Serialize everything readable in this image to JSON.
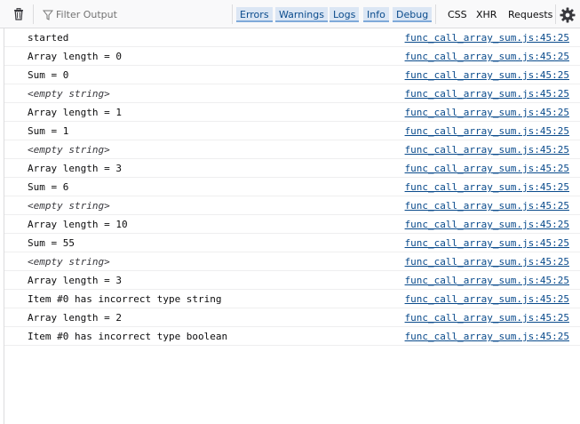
{
  "toolbar": {
    "filter_placeholder": "Filter Output",
    "levels": [
      "Errors",
      "Warnings",
      "Logs",
      "Info",
      "Debug"
    ],
    "requests": [
      "CSS",
      "XHR",
      "Requests"
    ]
  },
  "log": {
    "rows": [
      {
        "message": "started",
        "source": "func_call_array_sum.js:45:25",
        "empty": false
      },
      {
        "message": "Array length = 0",
        "source": "func_call_array_sum.js:45:25",
        "empty": false
      },
      {
        "message": "Sum = 0",
        "source": "func_call_array_sum.js:45:25",
        "empty": false
      },
      {
        "message": "<empty string>",
        "source": "func_call_array_sum.js:45:25",
        "empty": true
      },
      {
        "message": "Array length = 1",
        "source": "func_call_array_sum.js:45:25",
        "empty": false
      },
      {
        "message": "Sum = 1",
        "source": "func_call_array_sum.js:45:25",
        "empty": false
      },
      {
        "message": "<empty string>",
        "source": "func_call_array_sum.js:45:25",
        "empty": true
      },
      {
        "message": "Array length = 3",
        "source": "func_call_array_sum.js:45:25",
        "empty": false
      },
      {
        "message": "Sum = 6",
        "source": "func_call_array_sum.js:45:25",
        "empty": false
      },
      {
        "message": "<empty string>",
        "source": "func_call_array_sum.js:45:25",
        "empty": true
      },
      {
        "message": "Array length = 10",
        "source": "func_call_array_sum.js:45:25",
        "empty": false
      },
      {
        "message": "Sum = 55",
        "source": "func_call_array_sum.js:45:25",
        "empty": false
      },
      {
        "message": "<empty string>",
        "source": "func_call_array_sum.js:45:25",
        "empty": true
      },
      {
        "message": "Array length = 3",
        "source": "func_call_array_sum.js:45:25",
        "empty": false
      },
      {
        "message": "Item #0 has incorrect type string",
        "source": "func_call_array_sum.js:45:25",
        "empty": false
      },
      {
        "message": "Array length = 2",
        "source": "func_call_array_sum.js:45:25",
        "empty": false
      },
      {
        "message": "Item #0 has incorrect type boolean",
        "source": "func_call_array_sum.js:45:25",
        "empty": false
      }
    ]
  },
  "icons": {
    "clear": "trash-icon",
    "filter": "filter-icon",
    "settings": "gear-icon"
  },
  "colors": {
    "toolbar_bg": "#f9f9fa",
    "level_active_bg": "#dbe6f4",
    "link": "#0a4b8c"
  }
}
